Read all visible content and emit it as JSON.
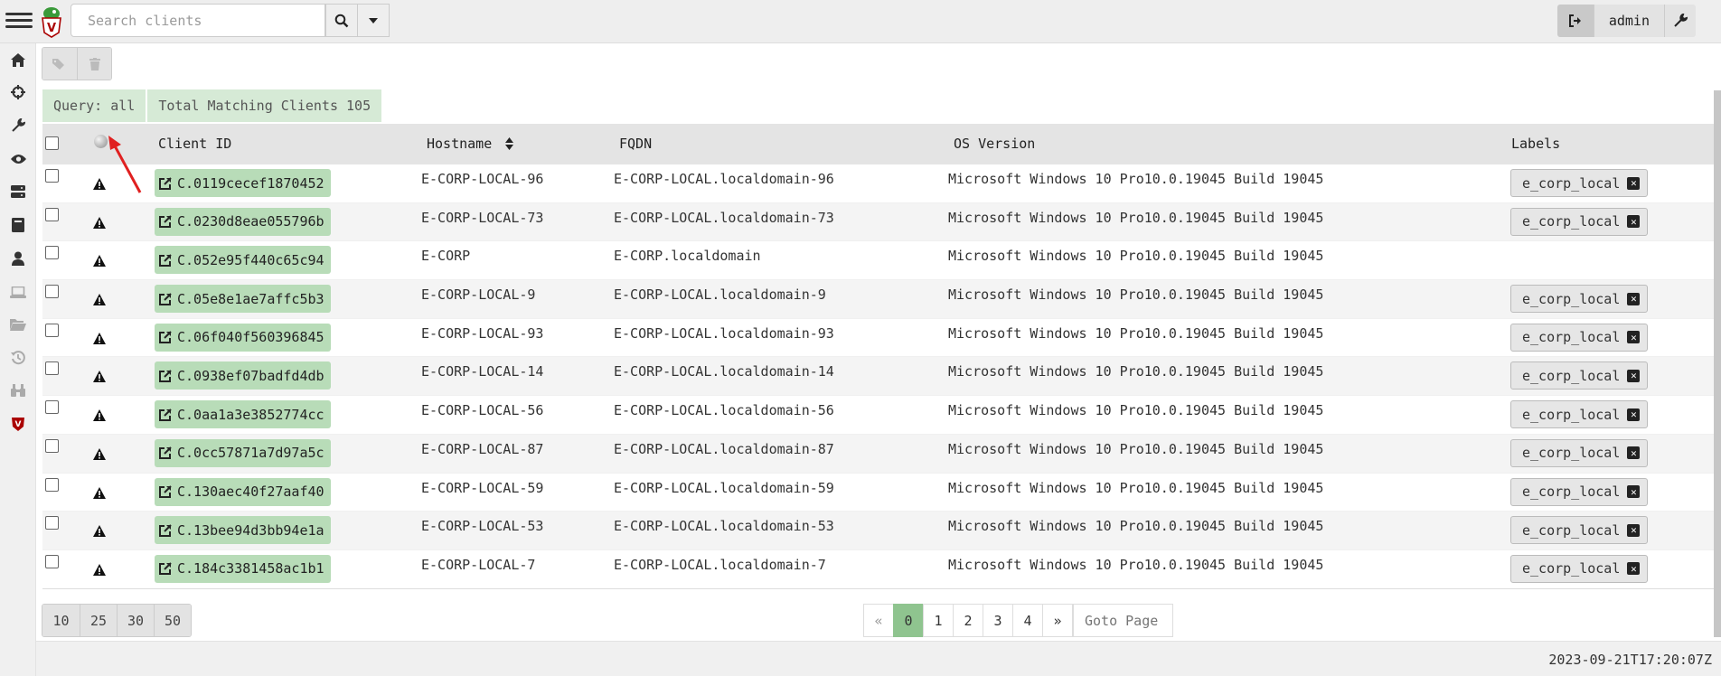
{
  "search": {
    "placeholder": "Search clients"
  },
  "user": {
    "name": "admin"
  },
  "query": {
    "label": "Query: all",
    "total": "Total Matching Clients 105"
  },
  "columns": {
    "client_id": "Client ID",
    "hostname": "Hostname",
    "fqdn": "FQDN",
    "os": "OS Version",
    "labels": "Labels"
  },
  "rows": [
    {
      "client_id": "C.0119cecef1870452",
      "hostname": "E-CORP-LOCAL-96",
      "fqdn": "E-CORP-LOCAL.localdomain-96",
      "os": "Microsoft Windows 10 Pro10.0.19045 Build 19045",
      "label": "e_corp_local"
    },
    {
      "client_id": "C.0230d8eae055796b",
      "hostname": "E-CORP-LOCAL-73",
      "fqdn": "E-CORP-LOCAL.localdomain-73",
      "os": "Microsoft Windows 10 Pro10.0.19045 Build 19045",
      "label": "e_corp_local"
    },
    {
      "client_id": "C.052e95f440c65c94",
      "hostname": "E-CORP",
      "fqdn": "E-CORP.localdomain",
      "os": "Microsoft Windows 10 Pro10.0.19045 Build 19045",
      "label": ""
    },
    {
      "client_id": "C.05e8e1ae7affc5b3",
      "hostname": "E-CORP-LOCAL-9",
      "fqdn": "E-CORP-LOCAL.localdomain-9",
      "os": "Microsoft Windows 10 Pro10.0.19045 Build 19045",
      "label": "e_corp_local"
    },
    {
      "client_id": "C.06f040f560396845",
      "hostname": "E-CORP-LOCAL-93",
      "fqdn": "E-CORP-LOCAL.localdomain-93",
      "os": "Microsoft Windows 10 Pro10.0.19045 Build 19045",
      "label": "e_corp_local"
    },
    {
      "client_id": "C.0938ef07badfd4db",
      "hostname": "E-CORP-LOCAL-14",
      "fqdn": "E-CORP-LOCAL.localdomain-14",
      "os": "Microsoft Windows 10 Pro10.0.19045 Build 19045",
      "label": "e_corp_local"
    },
    {
      "client_id": "C.0aa1a3e3852774cc",
      "hostname": "E-CORP-LOCAL-56",
      "fqdn": "E-CORP-LOCAL.localdomain-56",
      "os": "Microsoft Windows 10 Pro10.0.19045 Build 19045",
      "label": "e_corp_local"
    },
    {
      "client_id": "C.0cc57871a7d97a5c",
      "hostname": "E-CORP-LOCAL-87",
      "fqdn": "E-CORP-LOCAL.localdomain-87",
      "os": "Microsoft Windows 10 Pro10.0.19045 Build 19045",
      "label": "e_corp_local"
    },
    {
      "client_id": "C.130aec40f27aaf40",
      "hostname": "E-CORP-LOCAL-59",
      "fqdn": "E-CORP-LOCAL.localdomain-59",
      "os": "Microsoft Windows 10 Pro10.0.19045 Build 19045",
      "label": "e_corp_local"
    },
    {
      "client_id": "C.13bee94d3bb94e1a",
      "hostname": "E-CORP-LOCAL-53",
      "fqdn": "E-CORP-LOCAL.localdomain-53",
      "os": "Microsoft Windows 10 Pro10.0.19045 Build 19045",
      "label": "e_corp_local"
    },
    {
      "client_id": "C.184c3381458ac1b1",
      "hostname": "E-CORP-LOCAL-7",
      "fqdn": "E-CORP-LOCAL.localdomain-7",
      "os": "Microsoft Windows 10 Pro10.0.19045 Build 19045",
      "label": "e_corp_local"
    }
  ],
  "page_sizes": [
    "10",
    "25",
    "30",
    "50"
  ],
  "pagination": {
    "prev": "«",
    "pages": [
      "0",
      "1",
      "2",
      "3",
      "4"
    ],
    "active": "0",
    "next": "»",
    "goto_placeholder": "Goto Page"
  },
  "timestamp": "2023-09-21T17:20:07Z",
  "colors": {
    "accent_green": "#b8dcb8",
    "active_page": "#8fc48f",
    "annotation_arrow": "#e02020"
  }
}
